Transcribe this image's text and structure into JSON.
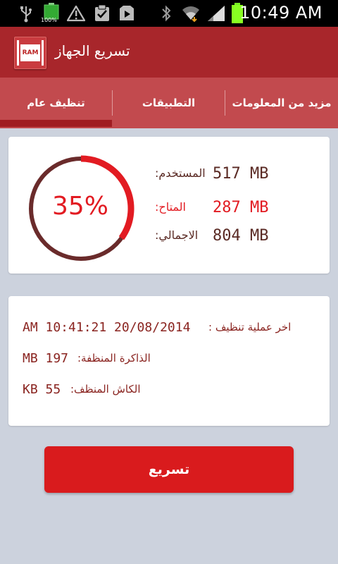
{
  "status_bar": {
    "time": "10:49 AM",
    "battery_small_label": "100%",
    "icons": [
      "usb-icon",
      "battery-small-icon",
      "warning-icon",
      "clipboard-check-icon",
      "play-store-icon",
      "bluetooth-icon",
      "wifi-icon",
      "signal-icon",
      "battery-icon"
    ]
  },
  "header": {
    "app_icon_text": "RAM",
    "title": "تسريع الجهاز"
  },
  "tabs": [
    {
      "label": "تنظيف عام",
      "selected": true
    },
    {
      "label": "التطبيقات",
      "selected": false
    },
    {
      "label": "مزيد من المعلومات",
      "selected": false
    }
  ],
  "memory": {
    "percent_label": "35%",
    "percent_value": 0.35,
    "used_value": "517 MB",
    "used_label": "المستخدم:",
    "available_value": "287 MB",
    "available_label": "المتاح:",
    "total_value": "804 MB",
    "total_label": "الاجمالي:"
  },
  "cleanup_info": {
    "last_clean_label": "اخر عملية تنظيف :",
    "last_clean_value": "AM 10:41:21 20/08/2014",
    "cleaned_memory_label": "الذاكرة المنظفة:",
    "cleaned_memory_value": "MB 197",
    "cleaned_cache_label": "الكاش المنظف:",
    "cleaned_cache_value": "KB 55"
  },
  "actions": {
    "boost_label": "تسريع"
  },
  "colors": {
    "status_bar": "#000000",
    "action_bar": "#a8262b",
    "tab_bar": "#c24a4e",
    "tab_indicator": "#a01d22",
    "accent_red": "#e21b22",
    "ring_track": "#6a2b2b",
    "text_brown": "#5a2a24",
    "background": "#ccd2dd",
    "button": "#d91b1d"
  }
}
